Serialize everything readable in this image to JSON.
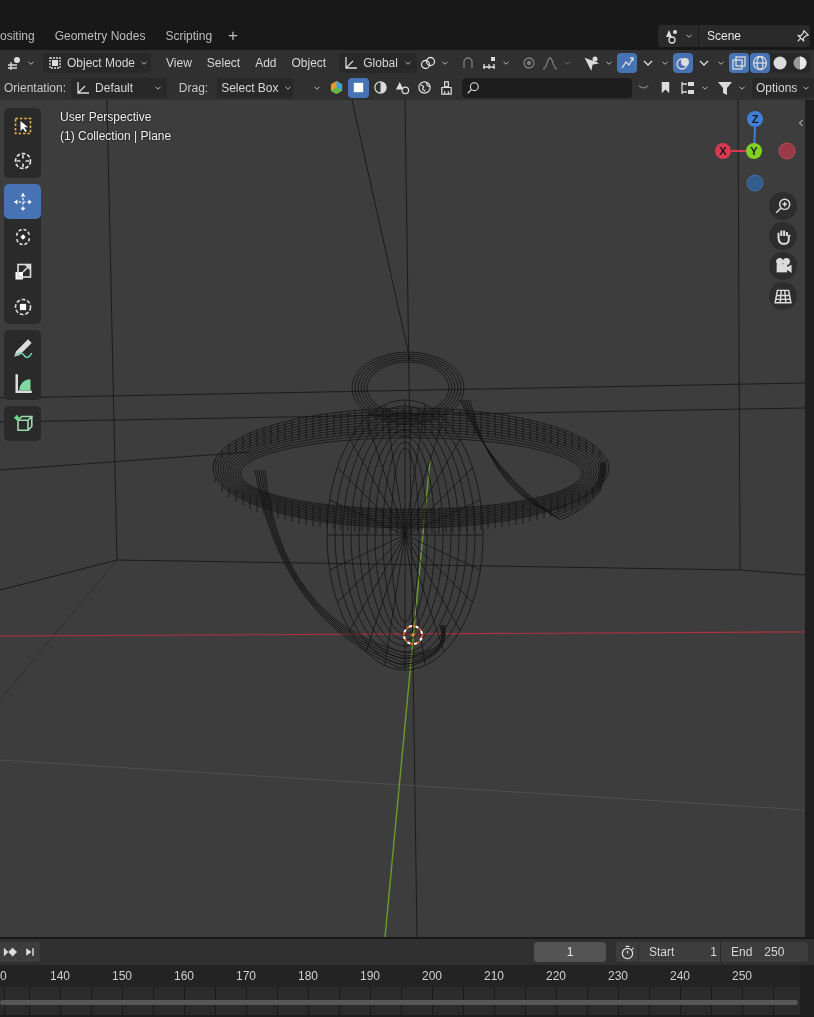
{
  "workspace_tabs": [
    {
      "label": "ositing",
      "selected": false
    },
    {
      "label": "Geometry Nodes",
      "selected": false
    },
    {
      "label": "Scripting",
      "selected": false
    }
  ],
  "add_workspace": "+",
  "scene": "Scene",
  "header": {
    "mode": "Object Mode",
    "menus": [
      "View",
      "Select",
      "Add",
      "Object"
    ],
    "orientation": "Global"
  },
  "toggles": [
    {
      "kind": "snap",
      "on": false
    },
    {
      "kind": "proportional",
      "on": false
    },
    {
      "kind": "gizmos",
      "on": true
    },
    {
      "kind": "overlays",
      "on": true
    },
    {
      "kind": "xray",
      "on": true
    }
  ],
  "shading_modes": [
    {
      "kind": "wireframe",
      "selected": true
    },
    {
      "kind": "solid",
      "selected": false
    },
    {
      "kind": "material",
      "selected": false
    }
  ],
  "tool_settings": {
    "orientation_label": "Orientation:",
    "orientation": "Default",
    "drag_label": "Drag:",
    "drag": "Select Box",
    "options": "Options"
  },
  "display_modes": [
    {
      "kind": "box",
      "selected": true
    },
    {
      "kind": "sphere",
      "selected": false
    },
    {
      "kind": "shapes",
      "selected": false
    },
    {
      "kind": "globe",
      "selected": false
    },
    {
      "kind": "brush",
      "selected": false
    }
  ],
  "tools": [
    {
      "kind": "select",
      "selected": false
    },
    {
      "kind": "cursor",
      "selected": false
    },
    {
      "kind": "move",
      "selected": true
    },
    {
      "kind": "rotate",
      "selected": false
    },
    {
      "kind": "scale",
      "selected": false
    },
    {
      "kind": "transform",
      "selected": false
    },
    {
      "kind": "annotate",
      "selected": false
    },
    {
      "kind": "measure",
      "selected": false
    },
    {
      "kind": "addcube",
      "selected": false
    }
  ],
  "viewport": {
    "view_name": "User Perspective",
    "context": "(1) Collection | Plane"
  },
  "axes": [
    {
      "label": "Z",
      "color": "#3f7fd6"
    },
    {
      "label": "X",
      "color": "#d8394e"
    },
    {
      "label": "Y",
      "color": "#7fcf25"
    }
  ],
  "timeline": {
    "current_frame": "1",
    "start_label": "Start",
    "start": "1",
    "end_label": "End",
    "end": "250",
    "ruler": [
      "0",
      "140",
      "150",
      "160",
      "170",
      "180",
      "190",
      "200",
      "210",
      "220",
      "230",
      "240",
      "250"
    ]
  }
}
